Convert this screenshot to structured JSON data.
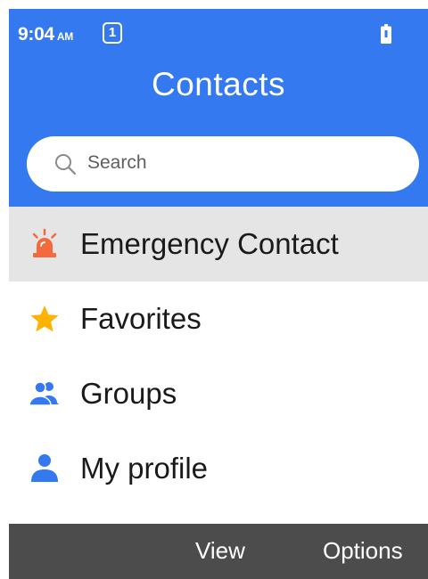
{
  "status_bar": {
    "time": "9:04",
    "ampm": "AM",
    "sim_slot": "1",
    "battery_icon": "battery-icon"
  },
  "header": {
    "title": "Contacts",
    "color": "#3579f0"
  },
  "search": {
    "placeholder": "Search",
    "icon": "search-icon"
  },
  "menu": {
    "items": [
      {
        "label": "Emergency Contact",
        "icon": "siren-icon",
        "icon_color": "#f26a3d",
        "selected": true
      },
      {
        "label": "Favorites",
        "icon": "star-icon",
        "icon_color": "#ffb300",
        "selected": false
      },
      {
        "label": "Groups",
        "icon": "group-icon",
        "icon_color": "#3579f0",
        "selected": false
      },
      {
        "label": "My profile",
        "icon": "person-icon",
        "icon_color": "#3579f0",
        "selected": false
      }
    ]
  },
  "softkeys": {
    "left": "",
    "center": "View",
    "right": "Options"
  }
}
